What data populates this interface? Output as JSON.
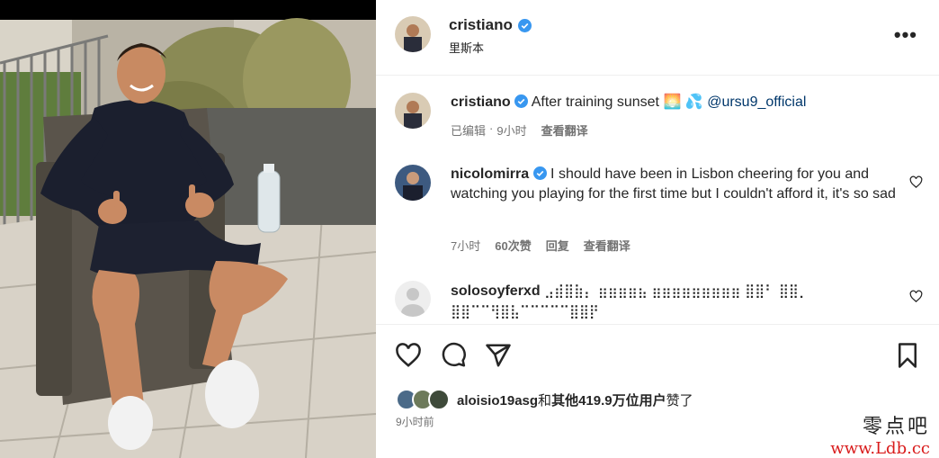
{
  "post": {
    "image_alt": "Photo of a man sitting in a chair on a terrace giving thumbs up",
    "author": "cristiano",
    "location": "里斯本",
    "more_glyph": "•••"
  },
  "caption": {
    "user": "cristiano",
    "text": "After training sunset",
    "emoji": "🌅 💦",
    "mention": "@ursu9_official",
    "edited": "已编辑",
    "dot": "·",
    "time": "9小时",
    "translate": "查看翻译"
  },
  "comments": [
    {
      "user": "nicolomirra",
      "text": "I should have been in Lisbon cheering for you and watching you playing for the first time but I couldn't afford it, it's so sad",
      "time": "7小时",
      "likes": "60次赞",
      "reply": "回复",
      "translate": "查看翻译"
    },
    {
      "user": "solosoyferxd",
      "text": "⣠⣾⣿⣷⡄ ⣶⣶⣶⣶⣦ ⣶⣶⣶⣶⣶⣶⣶⣶⣶ ⣿⣿⠃ ⣿⣿⡀ ⣿⣿⠉⠉⢻⣿⣧⠉⠉⠉⠉⠉⣿⣿⡟"
    }
  ],
  "likes": {
    "users": "aloisio19asg",
    "connector": "和",
    "others": "其他419.9万位用户",
    "suffix": "赞了"
  },
  "post_time": "9小时前",
  "watermark": {
    "top": "零点吧",
    "bottom": "www.Ldb.cc"
  },
  "colors": {
    "verified": "#3897f0",
    "mention": "#00376b",
    "meta": "#737373",
    "watermark_red": "#d91c1c"
  },
  "icons": [
    "verified-badge-icon",
    "more-options-icon",
    "heart-icon",
    "comment-icon",
    "share-icon",
    "bookmark-icon"
  ]
}
